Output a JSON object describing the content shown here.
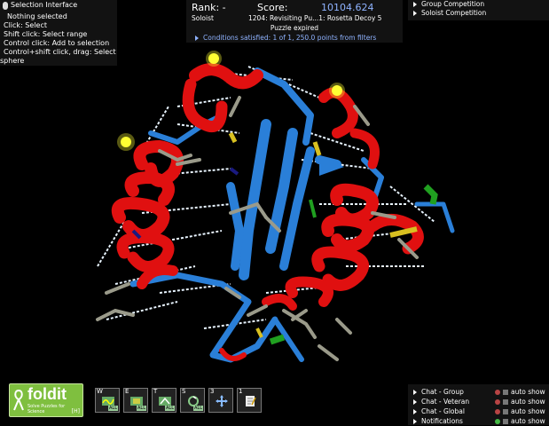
{
  "selection_panel": {
    "title": "Selection Interface",
    "lines": [
      "Nothing selected",
      "Click: Select",
      "Shift click: Select range",
      "Control click: Add to selection",
      "Control+shift click, drag: Select",
      "sphere"
    ]
  },
  "score_panel": {
    "rank_label": "Rank: -",
    "score_label": "Score:",
    "score_value": "10104.624",
    "mode": "Soloist",
    "puzzle": "1204: Revisiting Pu...1: Rosetta Decoy 5",
    "status": "Puzzle expired",
    "conditions": "Conditions satisfied: 1 of 1, 250.0 points from filters"
  },
  "competition": [
    "Group Competition",
    "Soloist Competition"
  ],
  "chat": [
    {
      "label": "Chat - Group",
      "auto": "auto show",
      "on": false
    },
    {
      "label": "Chat - Veteran",
      "auto": "auto show",
      "on": false
    },
    {
      "label": "Chat - Global",
      "auto": "auto show",
      "on": false
    },
    {
      "label": "Notifications",
      "auto": "auto show",
      "on": true
    }
  ],
  "logo": {
    "word": "foldit",
    "tagline": "Solve Puzzles for Science",
    "help_key": "[H]"
  },
  "tools": [
    {
      "key": "W",
      "icon": "wiggle-all-icon",
      "badge": "ALL"
    },
    {
      "key": "E",
      "icon": "shake-all-icon",
      "badge": "ALL"
    },
    {
      "key": "T",
      "icon": "wiggle-sidechains-all-icon",
      "badge": "ALL"
    },
    {
      "key": "S",
      "icon": "shake-sidechains-all-icon",
      "badge": "ALL"
    },
    {
      "key": "3",
      "icon": "move-arrows-icon",
      "badge": ""
    },
    {
      "key": "1",
      "icon": "notes-icon",
      "badge": ""
    }
  ],
  "colors": {
    "helix": "#e01010",
    "sheet": "#2a7fd8",
    "loop": "#2a7fd8",
    "hbond": "#e8f4ff",
    "sidechain": "#9a9a8a",
    "highlight": "#ffff33",
    "accent_text": "#8fb3ff"
  }
}
